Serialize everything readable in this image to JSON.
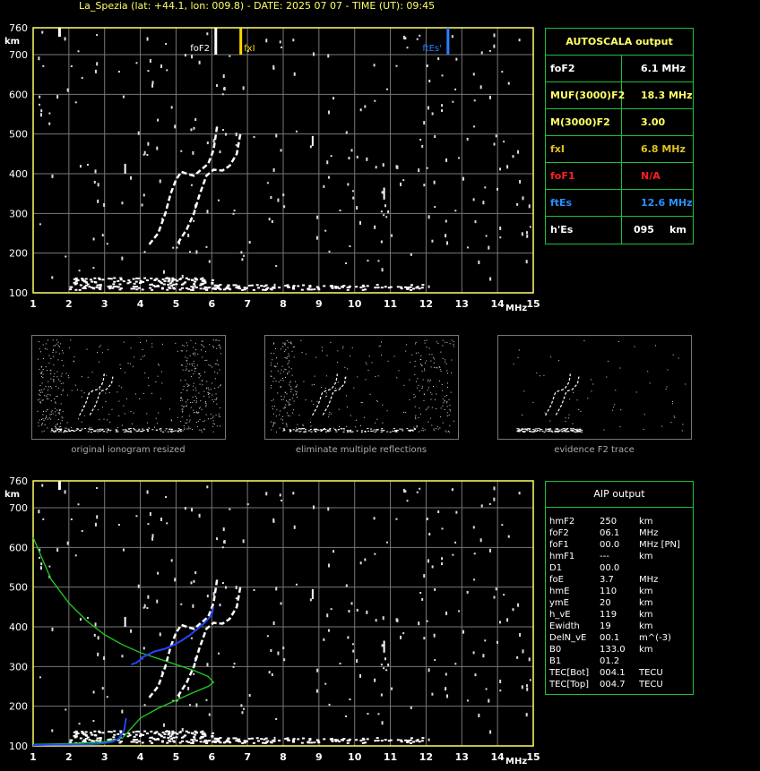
{
  "header": {
    "title": "La_Spezia (lat: +44.1, lon: 009.8) - DATE: 2025 07 07 - TIME (UT): 09:45"
  },
  "plot": {
    "y_unit": "km",
    "x_unit": "MHz",
    "y_ticks": [
      "760",
      "700",
      "600",
      "500",
      "400",
      "300",
      "200",
      "100"
    ],
    "x_ticks": [
      "1",
      "2",
      "3",
      "4",
      "5",
      "6",
      "7",
      "8",
      "9",
      "10",
      "11",
      "12",
      "13",
      "14",
      "15"
    ],
    "markers": {
      "foF2": "foF2",
      "fxI": "fxI",
      "ftEs": "ftEs'"
    },
    "colors": {
      "grid": "#777777",
      "axis": "#ffff66",
      "foF2": "#ffffff",
      "fxI": "#ffd700",
      "ftEs": "#2a7fff"
    }
  },
  "autoscala": {
    "header": "AUTOSCALA output",
    "rows": [
      {
        "label": "foF2",
        "value": "6.1 MHz",
        "color": "#ffffff"
      },
      {
        "label": "MUF(3000)F2",
        "value": "18.3 MHz",
        "color": "#ffff66"
      },
      {
        "label": "M(3000)F2",
        "value": "3.00",
        "color": "#ffff66"
      },
      {
        "label": "fxI",
        "value": "6.8 MHz",
        "color": "#e0c020"
      },
      {
        "label": "foF1",
        "value": "N/A",
        "color": "#ff2020"
      },
      {
        "label": "ftEs",
        "value": "12.6 MHz",
        "color": "#2a8fff"
      },
      {
        "label": "h'Es",
        "value": "095",
        "unit": "km",
        "color": "#ffffff"
      }
    ]
  },
  "thumbnails": [
    {
      "caption": "original ionogram resized"
    },
    {
      "caption": "eliminate multiple reflections"
    },
    {
      "caption": "evidence F2 trace"
    }
  ],
  "aip": {
    "header": "AIP output",
    "rows": [
      {
        "label": "hmF2",
        "value": "250",
        "unit": "km"
      },
      {
        "label": "foF2",
        "value": "06.1",
        "unit": "MHz"
      },
      {
        "label": "foF1",
        "value": "00.0",
        "unit": "MHz   [PN]"
      },
      {
        "label": "hmF1",
        "value": "---",
        "unit": "km"
      },
      {
        "label": "D1",
        "value": "00.0",
        "unit": ""
      },
      {
        "label": "foE",
        "value": "3.7",
        "unit": "MHz"
      },
      {
        "label": "hmE",
        "value": "110",
        "unit": "km"
      },
      {
        "label": "ymE",
        "value": "20",
        "unit": "km"
      },
      {
        "label": "h_vE",
        "value": "119",
        "unit": "km"
      },
      {
        "label": "Ewidth",
        "value": "19",
        "unit": "km"
      },
      {
        "label": "DelN_vE",
        "value": "00.1",
        "unit": "m^(-3)"
      },
      {
        "label": "B0",
        "value": "133.0",
        "unit": "km"
      },
      {
        "label": "B1",
        "value": "01.2",
        "unit": ""
      },
      {
        "label": "TEC[Bot]",
        "value": "004.1",
        "unit": "TECU"
      },
      {
        "label": "TEC[Top]",
        "value": "004.7",
        "unit": "TECU"
      }
    ]
  }
}
